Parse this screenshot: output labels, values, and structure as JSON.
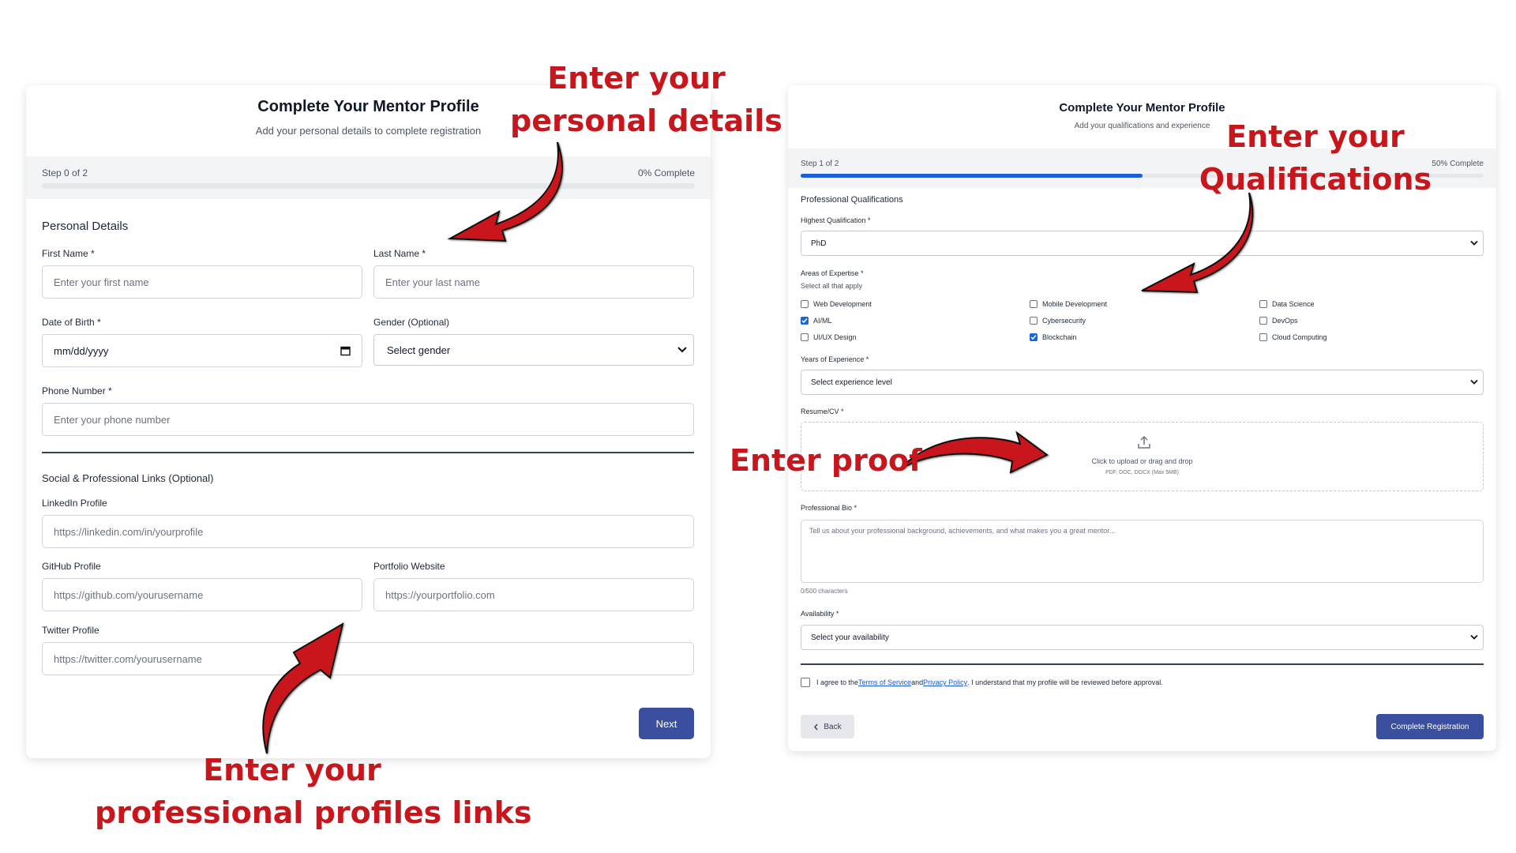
{
  "left": {
    "title": "Complete Your Mentor Profile",
    "subtitle": "Add your personal details to complete registration",
    "step_text": "Step 0 of 2",
    "percent_text": "0% Complete",
    "progress": 0,
    "section_personal": "Personal Details",
    "first_name": {
      "label": "First Name *",
      "placeholder": "Enter your first name",
      "value": ""
    },
    "last_name": {
      "label": "Last Name *",
      "placeholder": "Enter your last name",
      "value": ""
    },
    "dob": {
      "label": "Date of Birth *",
      "value": "mm/dd/yyyy"
    },
    "gender": {
      "label": "Gender (Optional)",
      "value": "Select gender"
    },
    "phone": {
      "label": "Phone Number *",
      "placeholder": "Enter your phone number",
      "value": ""
    },
    "section_social": "Social & Professional Links (Optional)",
    "linkedin": {
      "label": "LinkedIn Profile",
      "placeholder": "https://linkedin.com/in/yourprofile"
    },
    "github": {
      "label": "GitHub Profile",
      "placeholder": "https://github.com/yourusername"
    },
    "portfolio": {
      "label": "Portfolio Website",
      "placeholder": "https://yourportfolio.com"
    },
    "twitter": {
      "label": "Twitter Profile",
      "placeholder": "https://twitter.com/yourusername"
    },
    "next_label": "Next"
  },
  "right": {
    "title": "Complete Your Mentor Profile",
    "subtitle": "Add your qualifications and experience",
    "step_text": "Step 1 of 2",
    "percent_text": "50% Complete",
    "progress": 0.5,
    "section": "Professional Qualifications",
    "qualification": {
      "label": "Highest Qualification *",
      "value": "PhD"
    },
    "expertise": {
      "label": "Areas of Expertise *",
      "hint": "Select all that apply",
      "options": [
        {
          "label": "Web Development",
          "checked": false
        },
        {
          "label": "Mobile Development",
          "checked": false
        },
        {
          "label": "Data Science",
          "checked": false
        },
        {
          "label": "AI/ML",
          "checked": true
        },
        {
          "label": "Cybersecurity",
          "checked": false
        },
        {
          "label": "DevOps",
          "checked": false
        },
        {
          "label": "UI/UX Design",
          "checked": false
        },
        {
          "label": "Blockchain",
          "checked": true
        },
        {
          "label": "Cloud Computing",
          "checked": false
        }
      ]
    },
    "experience": {
      "label": "Years of Experience *",
      "value": "Select experience level"
    },
    "resume": {
      "label": "Resume/CV *",
      "upload_text": "Click to upload or drag and drop",
      "formats": "PDF, DOC, DOCX (Max 5MB)"
    },
    "bio": {
      "label": "Professional Bio *",
      "placeholder": "Tell us about your professional background, achievements, and what makes you a great mentor...",
      "counter": "0/500 characters"
    },
    "availability": {
      "label": "Availability *",
      "value": "Select your availability"
    },
    "terms": {
      "pre": "I agree to the ",
      "tos": "Terms of Service",
      "mid": " and ",
      "privacy": "Privacy Policy",
      "post": ". I understand that my profile will be reviewed before approval.",
      "checked": false
    },
    "back_label": "Back",
    "submit_label": "Complete Registration"
  },
  "annotations": {
    "personal": [
      "Enter your",
      "personal details"
    ],
    "qualifications": [
      "Enter your",
      "Qualifications"
    ],
    "proof": "Enter proof",
    "links": [
      "Enter your",
      "professional profiles links"
    ]
  },
  "colors": {
    "annotation": "#c8161d",
    "primary_button": "#3b4fa0",
    "progress_fill": "#1d5fd6",
    "checkbox_checked": "#1a66d9"
  }
}
